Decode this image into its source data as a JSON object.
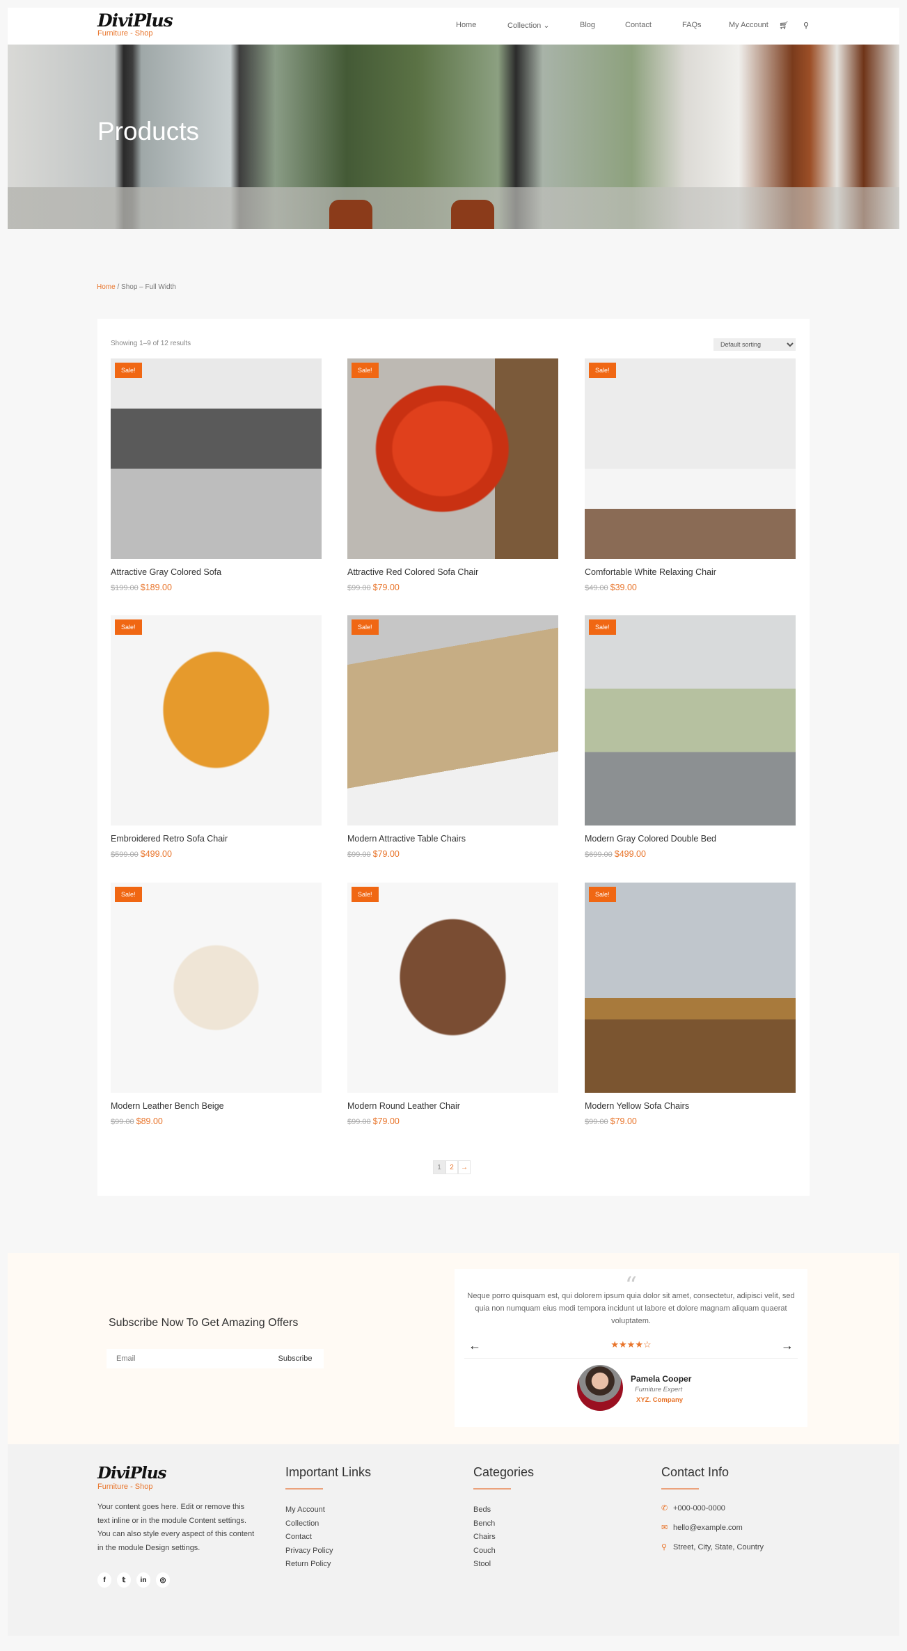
{
  "brand": {
    "name": "DiviPlus",
    "tagline": "Furniture - Shop"
  },
  "nav": {
    "items": [
      "Home",
      "Collection",
      "Blog",
      "Contact",
      "FAQs",
      "My Account"
    ],
    "collection_chevron": "⌄",
    "cart_icon": "cart-icon",
    "search_icon": "search-icon"
  },
  "hero": {
    "title": "Products"
  },
  "breadcrumb": {
    "home": "Home",
    "sep": " / ",
    "current": "Shop – Full Width"
  },
  "shop": {
    "result_count": "Showing 1–9 of 12 results",
    "sort_selected": "Default sorting",
    "sale_badge": "Sale!",
    "products": [
      {
        "title": "Attractive Gray Colored Sofa",
        "old_price": "$199.00",
        "price": "$189.00"
      },
      {
        "title": "Attractive Red Colored Sofa Chair",
        "old_price": "$99.00",
        "price": "$79.00"
      },
      {
        "title": "Comfortable White Relaxing Chair",
        "old_price": "$49.00",
        "price": "$39.00"
      },
      {
        "title": "Embroidered Retro Sofa Chair",
        "old_price": "$599.00",
        "price": "$499.00"
      },
      {
        "title": "Modern Attractive Table Chairs",
        "old_price": "$99.00",
        "price": "$79.00"
      },
      {
        "title": "Modern Gray Colored Double Bed",
        "old_price": "$699.00",
        "price": "$499.00"
      },
      {
        "title": "Modern Leather Bench Beige",
        "old_price": "$99.00",
        "price": "$89.00"
      },
      {
        "title": "Modern Round Leather Chair",
        "old_price": "$99.00",
        "price": "$79.00"
      },
      {
        "title": "Modern Yellow Sofa Chairs",
        "old_price": "$99.00",
        "price": "$79.00"
      }
    ],
    "pagination": {
      "pages": [
        "1",
        "2"
      ],
      "current": "1",
      "next": "→"
    }
  },
  "subscribe": {
    "heading": "Subscribe Now To Get Amazing Offers",
    "email_placeholder": "Email",
    "button": "Subscribe"
  },
  "testimonial": {
    "quote_mark": "“",
    "text": "Neque porro quisquam est, qui dolorem ipsum quia dolor sit amet, consectetur, adipisci velit, sed quia non numquam eius modi tempora incidunt ut labore et dolore magnam aliquam quaerat voluptatem.",
    "rating": 4,
    "rating_max": 5,
    "stars": "★★★★☆",
    "name": "Pamela Cooper",
    "role": "Furniture Expert",
    "company": "XYZ. Company",
    "prev": "←",
    "next": "→"
  },
  "footer": {
    "about": "Your content goes here. Edit or remove this text inline or in the module Content settings. You can also style every aspect of this content in the module Design settings.",
    "social": [
      "f",
      "t",
      "in",
      "ig"
    ],
    "links_heading": "Important Links",
    "links": [
      "My Account",
      "Collection",
      "Contact",
      "Privacy Policy",
      "Return Policy"
    ],
    "categories_heading": "Categories",
    "categories": [
      "Beds",
      "Bench",
      "Chairs",
      "Couch",
      "Stool"
    ],
    "contact_heading": "Contact Info",
    "phone": "+000-000-0000",
    "email": "hello@example.com",
    "address": "Street, City, State, Country"
  },
  "colors": {
    "accent": "#e8742a",
    "sale": "#f06713"
  }
}
